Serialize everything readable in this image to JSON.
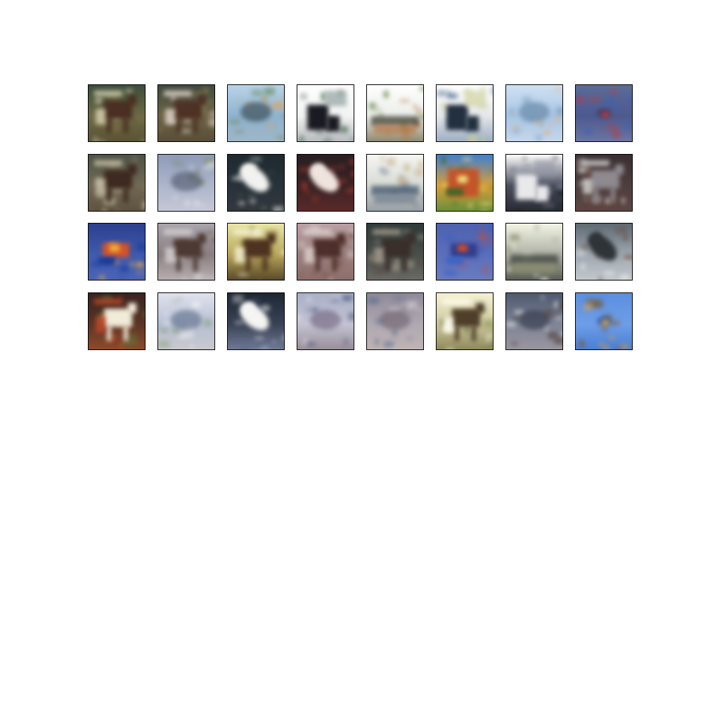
{
  "figure": {
    "description_colors": {
      "background": "#ffffff",
      "tile_border": "#000000"
    },
    "grid": {
      "rows": 4,
      "cols": 8
    },
    "samples": [
      {
        "bg": [
          "#3d4f3c",
          "#6e6a46",
          "#5b5436"
        ],
        "fg": "#4a2f22",
        "acc": [
          "#d9d4b5",
          "#8b7b4a"
        ],
        "shape": "animal"
      },
      {
        "bg": [
          "#3f4a3e",
          "#6e6448",
          "#5a4f38"
        ],
        "fg": "#4f3226",
        "acc": [
          "#e6d9cf",
          "#8e7e53"
        ],
        "shape": "animal"
      },
      {
        "bg": [
          "#b9d4e8",
          "#8fb3cf",
          "#9fb6c6"
        ],
        "fg": "#2f3f46",
        "acc": [
          "#e3a255",
          "#6b8a5b"
        ],
        "shape": "blob"
      },
      {
        "bg": [
          "#ffffff",
          "#f2f3f3",
          "#b9bcbe"
        ],
        "fg": "#1a1b22",
        "acc": [
          "#7f8f8f",
          "#2b5a3a"
        ],
        "shape": "dark-split"
      },
      {
        "bg": [
          "#ffffff",
          "#eceee9",
          "#8f8a73"
        ],
        "fg": "#3a3a30",
        "acc": [
          "#5a7f3a",
          "#b77b4b"
        ],
        "shape": "horizon"
      },
      {
        "bg": [
          "#ffffff",
          "#e5e7ea",
          "#9fb0c3"
        ],
        "fg": "#233040",
        "acc": [
          "#c9cf8f",
          "#4a6a8f"
        ],
        "shape": "dark-split"
      },
      {
        "bg": [
          "#cfe1f2",
          "#a9c6e6",
          "#c6d7ea"
        ],
        "fg": "#5b7f9c",
        "acc": [
          "#e2b26a",
          "#7fa3c7"
        ],
        "shape": "blob"
      },
      {
        "bg": [
          "#5c6c99",
          "#4e5a8f",
          "#6b76a3"
        ],
        "fg": "#3b3f6b",
        "acc": [
          "#c43a3a",
          "#3a62b8"
        ],
        "shape": "small"
      },
      {
        "bg": [
          "#4e5347",
          "#726a55",
          "#5e5341"
        ],
        "fg": "#3e2a20",
        "acc": [
          "#c9c2a9",
          "#8b7b58"
        ],
        "shape": "animal"
      },
      {
        "bg": [
          "#8f9cb9",
          "#aeb6cd",
          "#c6c8d6"
        ],
        "fg": "#4f566c",
        "acc": [
          "#7a8a6a",
          "#e8e8ee"
        ],
        "shape": "blob"
      },
      {
        "bg": [
          "#1f2b30",
          "#28323a",
          "#34383f"
        ],
        "fg": "#f2f2f0",
        "acc": [
          "#dadbd8",
          "#5b6b5f"
        ],
        "shape": "bright-blob"
      },
      {
        "bg": [
          "#2a1f22",
          "#3a2426",
          "#5b2a2a"
        ],
        "fg": "#f0e4df",
        "acc": [
          "#c23a2a",
          "#8e3a2f"
        ],
        "shape": "bright-blob"
      },
      {
        "bg": [
          "#f6f6f3",
          "#d7dbd5",
          "#9aa0a6"
        ],
        "fg": "#3b4f66",
        "acc": [
          "#c7b38b",
          "#6f7f8f"
        ],
        "shape": "horizon"
      },
      {
        "bg": [
          "#3f7fd0",
          "#d8a03a",
          "#6a8f3a"
        ],
        "fg": "#c4542a",
        "acc": [
          "#f2e07a",
          "#3a6a2a"
        ],
        "shape": "colorful"
      },
      {
        "bg": [
          "#ffffff",
          "#4a4f5f",
          "#2a2c35"
        ],
        "fg": "#e9e9ec",
        "acc": [
          "#8f93a3",
          "#1b1d25"
        ],
        "shape": "dark-split"
      },
      {
        "bg": [
          "#3a2f33",
          "#4e3f3f",
          "#5d4744"
        ],
        "fg": "#8f8a8f",
        "acc": [
          "#d9d8d4",
          "#6b3f2f"
        ],
        "shape": "animal"
      },
      {
        "bg": [
          "#2d3f8f",
          "#3f5cae",
          "#4a63b8"
        ],
        "fg": "#d4542a",
        "acc": [
          "#f0b13a",
          "#1b3a9a"
        ],
        "shape": "colorful-small"
      },
      {
        "bg": [
          "#aaa5ac",
          "#8a7f82",
          "#b8aeb0"
        ],
        "fg": "#4e3a34",
        "acc": [
          "#d8d4d4",
          "#6b5448"
        ],
        "shape": "animal"
      },
      {
        "bg": [
          "#e8e6a6",
          "#b9a75a",
          "#5b4a2a"
        ],
        "fg": "#4e3320",
        "acc": [
          "#f5f2d6",
          "#7f6b3a"
        ],
        "shape": "animal"
      },
      {
        "bg": [
          "#bba0a5",
          "#9a7f7f",
          "#8f6f6a"
        ],
        "fg": "#4e2f2a",
        "acc": [
          "#e0d4d0",
          "#6b4a3a"
        ],
        "shape": "animal"
      },
      {
        "bg": [
          "#2f3a3a",
          "#4a4f4a",
          "#6b6a66"
        ],
        "fg": "#3a2f2a",
        "acc": [
          "#a99f8f",
          "#5b4e45"
        ],
        "shape": "animal"
      },
      {
        "bg": [
          "#4e62b0",
          "#5b6fbb",
          "#6a7cc0"
        ],
        "fg": "#2f3f8f",
        "acc": [
          "#d44a2a",
          "#3a64c8"
        ],
        "shape": "colorful-small"
      },
      {
        "bg": [
          "#f3f4e5",
          "#aeb2a5",
          "#5a5f55"
        ],
        "fg": "#3a3f3a",
        "acc": [
          "#e8e8d2",
          "#8f8f6f"
        ],
        "shape": "horizon"
      },
      {
        "bg": [
          "#5f6b73",
          "#9fa7b0",
          "#c3c8ce"
        ],
        "fg": "#2f3438",
        "acc": [
          "#eef0f2",
          "#6b4a3f"
        ],
        "shape": "bright-blob"
      },
      {
        "bg": [
          "#3a2420",
          "#5b3526",
          "#8f4a2a"
        ],
        "fg": "#f0ecd9",
        "acc": [
          "#c44a2a",
          "#5a7a3a"
        ],
        "shape": "animal"
      },
      {
        "bg": [
          "#dfe3ee",
          "#b8c0d4",
          "#c9c9cf"
        ],
        "fg": "#5b6b85",
        "acc": [
          "#7f9a6a",
          "#f0f0f3"
        ],
        "shape": "blob"
      },
      {
        "bg": [
          "#1e2935",
          "#3a4256",
          "#6f7a96"
        ],
        "fg": "#f5f5f3",
        "acc": [
          "#dcdcde",
          "#4a5268"
        ],
        "shape": "bright-blob"
      },
      {
        "bg": [
          "#aab0c8",
          "#c4c4d4",
          "#9a8f99"
        ],
        "fg": "#6b5f7a",
        "acc": [
          "#e8e4ea",
          "#4a5a7f"
        ],
        "shape": "blob"
      },
      {
        "bg": [
          "#8f8a99",
          "#b0a9b3",
          "#c0b4b4"
        ],
        "fg": "#6b5f6a",
        "acc": [
          "#d9d4d9",
          "#5b6f8f"
        ],
        "shape": "blob"
      },
      {
        "bg": [
          "#f5f2d2",
          "#cfc9a0",
          "#8f8a5a"
        ],
        "fg": "#4f3f2a",
        "acc": [
          "#fffdf0",
          "#6b7f3a"
        ],
        "shape": "animal"
      },
      {
        "bg": [
          "#4f5a6f",
          "#7f8596",
          "#9a969f"
        ],
        "fg": "#2f3345",
        "acc": [
          "#e9ecef",
          "#5b4a4a"
        ],
        "shape": "blob"
      },
      {
        "bg": [
          "#5b8fe0",
          "#6f9ee8",
          "#4a7fd6"
        ],
        "fg": "#2f5fb8",
        "acc": [
          "#e0a03a",
          "#7a5a2a"
        ],
        "shape": "small"
      }
    ]
  }
}
